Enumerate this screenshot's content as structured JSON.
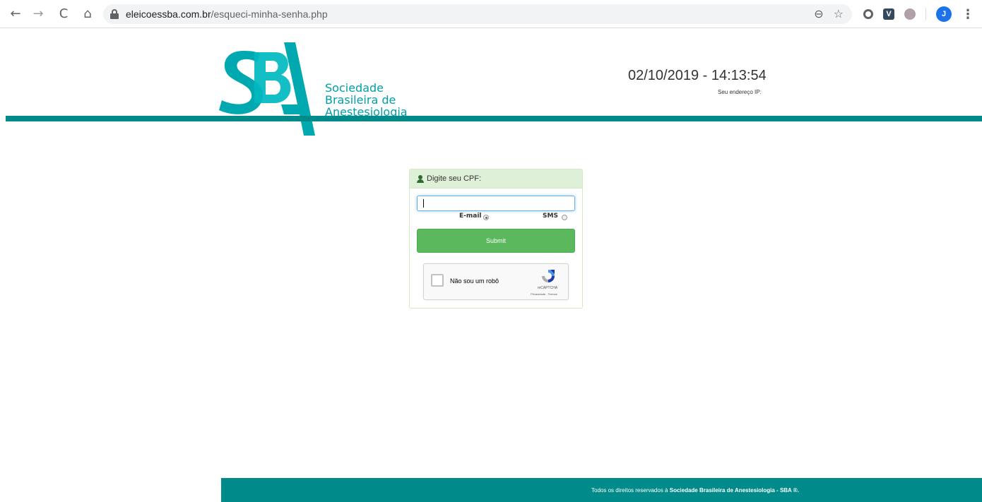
{
  "browser": {
    "url_host": "eleicoessba.com.br",
    "url_path": "/esqueci-minha-senha.php",
    "nav_back": "←",
    "nav_forward": "→",
    "nav_reload": "C",
    "nav_home": "⌂",
    "zoom_icon": "⊖",
    "star_icon": "☆",
    "extension_v": "V",
    "profile_initial": "J",
    "menu_icon": "⋮"
  },
  "header": {
    "logo_mark_text": "SBA",
    "logo_name_line1": "Sociedade",
    "logo_name_line2": "Brasileira de",
    "logo_name_line3": "Anestesiologia",
    "datetime": "02/10/2019 - 14:13:54",
    "ip_label": "Seu endereço IP:",
    "brand_color": "#00a0a8",
    "rule_color": "#008a8a"
  },
  "form": {
    "heading": "Digite seu CPF:",
    "cpf_value": "",
    "option_email": "E-mail",
    "option_sms": "SMS",
    "selected_option": "E-mail",
    "submit_label": "Submit",
    "submit_color": "#5cb85c"
  },
  "recaptcha": {
    "label": "Não sou um robô",
    "brand": "reCAPTCHA",
    "links": "Privacidade - Termos"
  },
  "footer": {
    "text_prefix": "Todos os direitos reservados à ",
    "text_bold": "Sociedade Brasileira de Anestesiologia - SBA ®."
  }
}
